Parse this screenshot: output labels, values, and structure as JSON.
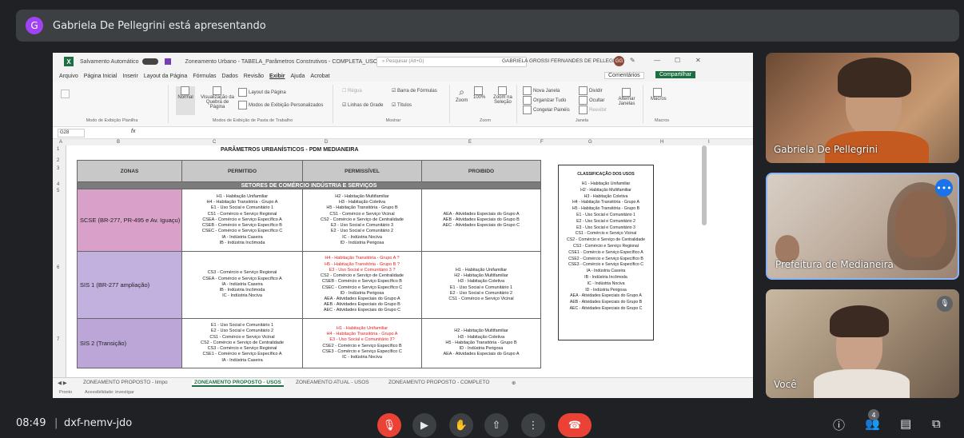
{
  "presenter": {
    "initial": "G",
    "text": "Gabriela De Pellegrini está apresentando"
  },
  "excel": {
    "autosave_label": "Salvamento Automático",
    "doc_name": "Zoneamento Urbano - TABELA_Parâmetros Construtivos - COMPLETA_USOS_V01",
    "search_placeholder": "Pesquisar (Alt+G)",
    "user_name": "GABRIELA GROSSI FERNANDES DE PELLEGRINI",
    "user_initials": "GG",
    "menu": [
      "Arquivo",
      "Página Inicial",
      "Inserir",
      "Layout da Página",
      "Fórmulas",
      "Dados",
      "Revisão",
      "Exibir",
      "Ajuda",
      "Acrobat"
    ],
    "active_menu": "Exibir",
    "comments_label": "Comentários",
    "share_label": "Compartilhar",
    "ribbon": {
      "g1_label": "Modo de Exibição Planilha",
      "normal": "Normal",
      "page_break": "Visualização da Quebra de Página",
      "page_layout": "Layout da Página",
      "custom_views": "Modos de Exibição Personalizados",
      "g2_label": "Modos de Exibição de Pasta de Trabalho",
      "ruler": "Régua",
      "formula_bar": "Barra de Fórmulas",
      "gridlines": "Linhas de Grade",
      "headings": "Títulos",
      "g3_label": "Mostrar",
      "zoom": "Zoom",
      "zoom100": "100%",
      "zoom_sel": "Zoom na Seleção",
      "g4_label": "Zoom",
      "new_window": "Nova Janela",
      "arrange_all": "Organizar Tudo",
      "freeze": "Congelar Painéis",
      "split": "Dividir",
      "hide": "Ocultar",
      "unhide": "Reexibir",
      "switch_windows": "Alternar Janelas",
      "g5_label": "Janela",
      "macros": "Macros",
      "g6_label": "Macros"
    },
    "name_box": "G28",
    "fx": "fx",
    "columns": [
      "A",
      "B",
      "C",
      "D",
      "E",
      "F",
      "G",
      "H",
      "I"
    ],
    "rows": [
      "1",
      "2",
      "3",
      "4",
      "5",
      "6",
      "7"
    ],
    "sheet_title": "PARÂMETROS URBANÍSTICOS - PDM MEDIANEIRA",
    "headers": [
      "ZONAS",
      "PERMITIDO",
      "PERMISSÍVEL",
      "PROIBIDO"
    ],
    "sector": "SETORES DE COMÉRCIO INDÚSTRIA E SERVIÇOS",
    "zones": [
      {
        "name": "SCSE (BR-277, PR-495 e Av. Iguaçu)",
        "permitido": [
          "H1 - Habitação Unifamiliar",
          "H4 - Habitação Transitória - Grupo A",
          "E1 - Uso Social e Comunitário 1",
          "CS1 - Comércio e Serviço Regional",
          "CSEA - Comércio e Serviço Específico A",
          "CSEB - Comércio e Serviço Específico B",
          "CSEC - Comércio e Serviço Específico C",
          "IA - Indústria Caseira",
          "IB - Indústria Incômoda"
        ],
        "permissivel": [
          "H2 - Habitação Multifamiliar",
          "H3 - Habitação Coletiva",
          "H5 - Habitação Transitória - Grupo B",
          "CS1 - Comércio e Serviço Vicinal",
          "CS2 - Comércio e Serviço de Centralidade",
          "E3 - Uso Social e Comunitário 3",
          "E2 - Uso Social e Comunitário 2",
          "IC - Indústria Nociva",
          "ID - Indústria Perigosa"
        ],
        "permissivel_red": [],
        "proibido": [
          "AEA - Atividades Especiais do Grupo A",
          "AEB - Atividades Especiais do Grupo B",
          "AEC - Atividades Especiais do Grupo C"
        ]
      },
      {
        "name": "SIS 1 (BR-277 ampliação)",
        "permitido": [
          "CS3 - Comércio e Serviço Regional",
          "CSEA - Comércio e Serviço Específico A",
          "IA - Indústria Caseira",
          "IB - Indústria Incômoda",
          "IC - Indústria Nociva"
        ],
        "permissivel_red": [
          "H4 - Habitação Transitória - Grupo A ?",
          "H5 - Habitação Transitória - Grupo B ?",
          "E3 - Uso Social e Comunitário 3 ?"
        ],
        "permissivel": [
          "CS2 - Comércio e Serviço de Centralidade",
          "CSEB - Comércio e Serviço Específico B",
          "CSEC - Comércio e Serviço Específico C",
          "ID - Indústria Perigosa",
          "AEA - Atividades Especiais do Grupo A",
          "AEB - Atividades Especiais do Grupo B",
          "AEC - Atividades Especiais do Grupo C"
        ],
        "proibido": [
          "H1 - Habitação Unifamiliar",
          "H2 - Habitação Multifamiliar",
          "H3 - Habitação Coletiva",
          "E1 - Uso Social e Comunitário 1",
          "E2 - Uso Social e Comunitário 2",
          "CS1 - Comércio e Serviço Vicinal"
        ]
      },
      {
        "name": "SIS 2 (Transição)",
        "permitido": [
          "E1 - Uso Social e Comunitário 1",
          "E2 - Uso Social e Comunitário 2",
          "CS1 - Comércio e Serviço Vicinal",
          "CS2 - Comércio e Serviço de Centralidade",
          "CS3 - Comércio e Serviço Regional",
          "CSE1 - Comércio e Serviço Específico A",
          "IA - Indústria Caseira"
        ],
        "permissivel_red": [
          "H1 - Habitação Unifamiliar",
          "H4 - Habitação Transitória - Grupo A",
          "E3 - Uso Social e Comunitário 3?"
        ],
        "permissivel": [
          "CSE2 - Comércio e Serviço Específico B",
          "CSE3 - Comércio e Serviço Específico C",
          "IC - Indústria Nociva"
        ],
        "proibido": [
          "H2 - Habitação Multifamiliar",
          "H3 - Habitação Coletiva",
          "H5 - Habitação Transitória - Grupo B",
          "ID - Indústria Perigosa",
          "AEA - Atividades Especiais do Grupo A"
        ]
      }
    ],
    "classification_title": "CLASSIFICAÇÃO DOS USOS",
    "classification": [
      "H1 - Habitação Unifamiliar",
      "H2 - Habitação Multifamiliar",
      "H3 - Habitação Coletiva",
      "H4 - Habitação Transitória - Grupo A",
      "H5 - Habitação Transitória - Grupo B",
      "E1 - Uso Social e Comunitário 1",
      "E2 - Uso Social e Comunitário 2",
      "E3 - Uso Social e Comunitário 3",
      "CS1 - Comércio e Serviço Vicinal",
      "CS2 - Comércio e Serviço de Centralidade",
      "CS3 - Comércio e Serviço Regional",
      "CSE1 - Comércio e Serviço Específico A",
      "CSE2 - Comércio e Serviço Específico B",
      "CSE3 - Comércio e Serviço Específico C",
      "IA - Indústria Caseira",
      "IB - Indústria Incômoda",
      "IC - Indústria Nociva",
      "ID - Indústria Perigosa",
      "AEA - Atividades Especiais do Grupo A",
      "AEB - Atividades Especiais do Grupo B",
      "AEC - Atividades Especiais do Grupo C"
    ],
    "tabs": [
      "ZONEAMENTO PROPOSTO - limpo",
      "ZONEAMENTO PROPOSTO - USOS",
      "ZONEAMENTO ATUAL - USOS",
      "ZONEAMENTO PROPOSTO - COMPLETO"
    ],
    "active_tab": "ZONEAMENTO PROPOSTO - USOS",
    "status_ready": "Pronto",
    "accessibility": "Acessibilidade: investigar"
  },
  "participants": [
    {
      "name": "Gabriela De Pellegrini"
    },
    {
      "name": "Prefeitura de Medianeira"
    },
    {
      "name": "Você"
    }
  ],
  "bottom_bar": {
    "time": "08:49",
    "separator": "|",
    "meeting_code": "dxf-nemv-jdo",
    "participant_count": "4"
  },
  "colors": {
    "presenter_avatar": "#a142f4",
    "excel_green": "#1d6f42",
    "hangup_red": "#ea4335",
    "active_tile_border": "#8ab4f8"
  }
}
